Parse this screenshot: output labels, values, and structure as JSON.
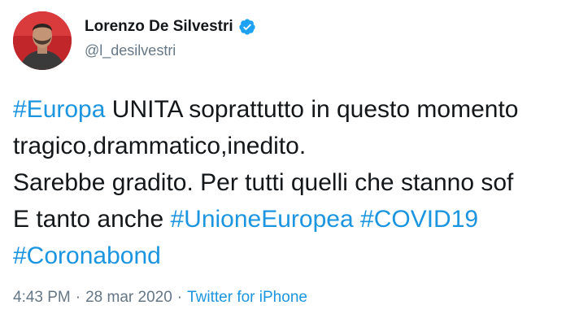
{
  "author": {
    "display_name": "Lorenzo De Silvestri",
    "handle": "@l_desilvestri",
    "verified": true
  },
  "tweet": {
    "lines": [
      [
        {
          "text": "#Europa",
          "type": "hashtag"
        },
        {
          "text": " UNITA soprattutto in questo momento",
          "type": "text"
        }
      ],
      [
        {
          "text": "tragico,drammatico,inedito.",
          "type": "text"
        }
      ],
      [
        {
          "text": "Sarebbe gradito. Per tutti quelli che stanno sof",
          "type": "text"
        }
      ],
      [
        {
          "text": "E tanto anche ",
          "type": "text"
        },
        {
          "text": "#UnioneEuropea",
          "type": "hashtag"
        },
        {
          "text": " ",
          "type": "text"
        },
        {
          "text": "#COVID19",
          "type": "hashtag"
        }
      ],
      [
        {
          "text": "#Coronabond",
          "type": "hashtag"
        }
      ]
    ]
  },
  "meta": {
    "time": "4:43 PM",
    "separator": "·",
    "date": "28 mar 2020",
    "source": "Twitter for iPhone"
  },
  "colors": {
    "link": "#1b95e0",
    "text": "#14171a",
    "secondary": "#657786",
    "verified_badge": "#1da1f2"
  },
  "icons": {
    "avatar": "profile-photo",
    "verified": "verified-badge-icon"
  }
}
